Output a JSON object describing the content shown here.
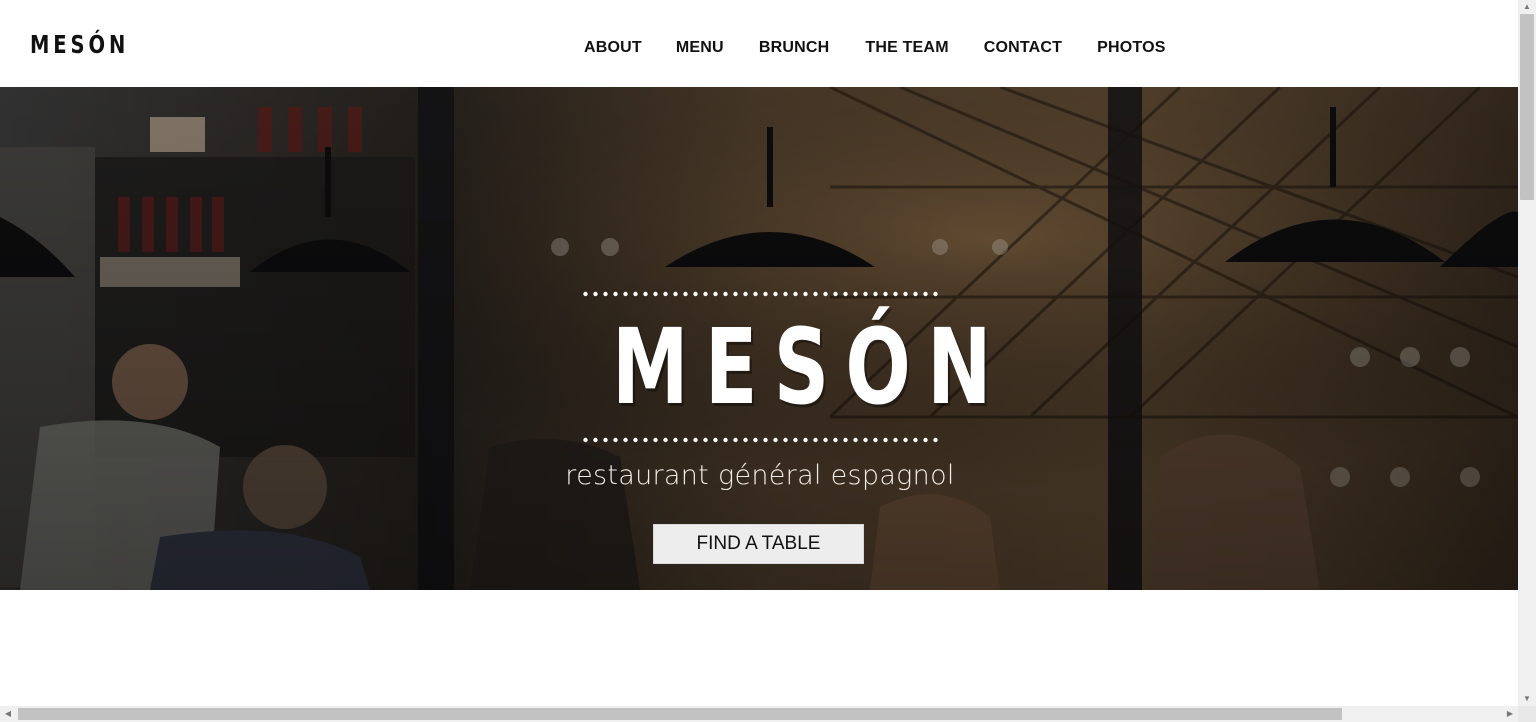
{
  "header": {
    "logo": "MESÓN",
    "nav": [
      "ABOUT",
      "MENU",
      "BRUNCH",
      "THE TEAM",
      "CONTACT",
      "PHOTOS"
    ]
  },
  "hero": {
    "title": "MESÓN",
    "subtitle": "restaurant général espagnol",
    "cta_label": "FIND A TABLE"
  },
  "colors": {
    "accent_text": "#ffffff",
    "nav_text": "#111111",
    "cta_bg": "#ededed"
  },
  "icons": {
    "scroll_up": "▲",
    "scroll_down": "▼",
    "scroll_left": "◀",
    "scroll_right": "▶"
  }
}
